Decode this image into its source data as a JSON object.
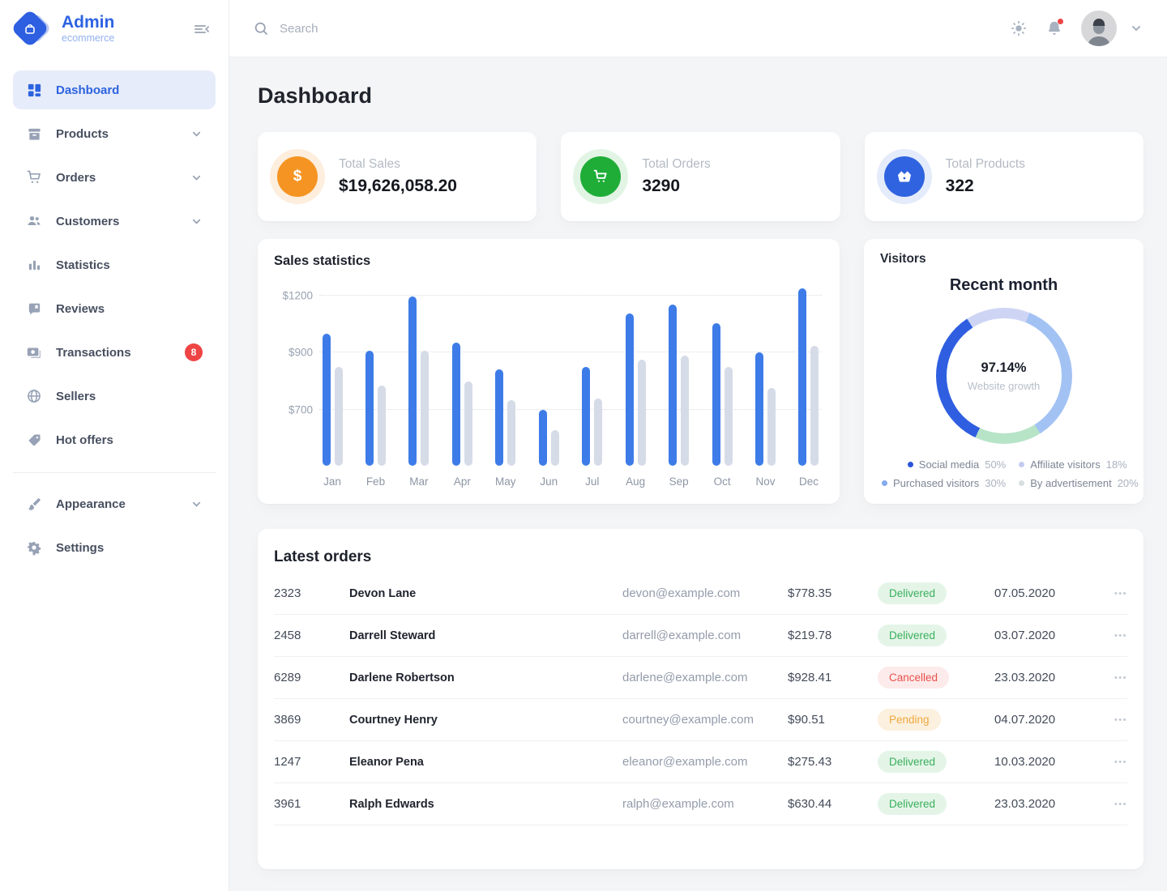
{
  "brand": {
    "name": "Admin",
    "subtitle": "ecommerce"
  },
  "topbar": {
    "search_placeholder": "Search"
  },
  "sidebar": {
    "items": [
      {
        "label": "Dashboard",
        "active": true
      },
      {
        "label": "Products",
        "chevron": true
      },
      {
        "label": "Orders",
        "chevron": true
      },
      {
        "label": "Customers",
        "chevron": true
      },
      {
        "label": "Statistics"
      },
      {
        "label": "Reviews"
      },
      {
        "label": "Transactions",
        "badge": "8"
      },
      {
        "label": "Sellers"
      },
      {
        "label": "Hot offers"
      }
    ],
    "footer_items": [
      {
        "label": "Appearance",
        "chevron": true
      },
      {
        "label": "Settings"
      }
    ]
  },
  "page": {
    "title": "Dashboard"
  },
  "stats": [
    {
      "label": "Total Sales",
      "value": "$19,626,058.20",
      "color": "#f59422",
      "halo": "#fdeedd",
      "icon": "dollar-icon"
    },
    {
      "label": "Total Orders",
      "value": "3290",
      "color": "#1fad38",
      "halo": "#e2f5e5",
      "icon": "cart-icon"
    },
    {
      "label": "Total Products",
      "value": "322",
      "color": "#2f63e0",
      "halo": "#e4ebfa",
      "icon": "basket-icon"
    }
  ],
  "chart_data": {
    "type": "bar",
    "title": "Sales statistics",
    "categories": [
      "Jan",
      "Feb",
      "Mar",
      "Apr",
      "May",
      "Jun",
      "Jul",
      "Aug",
      "Sep",
      "Oct",
      "Nov",
      "Dec"
    ],
    "series": [
      {
        "name": "current",
        "color": "#3d7ce8",
        "values": [
          1000,
          910,
          1195,
          950,
          840,
          700,
          850,
          1105,
          1155,
          1055,
          900,
          1240
        ]
      },
      {
        "name": "previous",
        "color": "#d5dbe7",
        "values": [
          850,
          785,
          910,
          800,
          735,
          635,
          740,
          875,
          890,
          850,
          775,
          935
        ]
      }
    ],
    "yticks": [
      {
        "label": "$700",
        "value": 700
      },
      {
        "label": "$900",
        "value": 900
      },
      {
        "label": "$1200",
        "value": 1200
      }
    ],
    "ylim": [
      520,
      1250
    ],
    "grid": "dotted-horizontal",
    "legend_position": "none"
  },
  "visitors": {
    "title": "Visitors",
    "heading": "Recent month",
    "center_value": "97.14%",
    "center_label": "Website growth",
    "donut_arcs": [
      {
        "color": "#a3c2f4",
        "from": 22,
        "to": 148
      },
      {
        "color": "#b7e4c7",
        "from": 148,
        "to": 205
      },
      {
        "color": "#2f5fe0",
        "from": 205,
        "to": 327
      },
      {
        "color": "#ced5f4",
        "from": 327,
        "to": 382
      }
    ],
    "legend": [
      {
        "label": "Social media",
        "pct": "50%",
        "color": "#2b55d9"
      },
      {
        "label": "Affiliate visitors",
        "pct": "18%",
        "color": "#c3cbf1"
      },
      {
        "label": "Purchased visitors",
        "pct": "30%",
        "color": "#86abef"
      },
      {
        "label": "By advertisement",
        "pct": "20%",
        "color": "#d7dee0"
      }
    ]
  },
  "orders": {
    "title": "Latest orders",
    "rows": [
      {
        "id": "2323",
        "name": "Devon Lane",
        "email": "devon@example.com",
        "amount": "$778.35",
        "status": "Delivered",
        "date": "07.05.2020"
      },
      {
        "id": "2458",
        "name": "Darrell Steward",
        "email": "darrell@example.com",
        "amount": "$219.78",
        "status": "Delivered",
        "date": "03.07.2020"
      },
      {
        "id": "6289",
        "name": "Darlene Robertson",
        "email": "darlene@example.com",
        "amount": "$928.41",
        "status": "Cancelled",
        "date": "23.03.2020"
      },
      {
        "id": "3869",
        "name": "Courtney Henry",
        "email": "courtney@example.com",
        "amount": "$90.51",
        "status": "Pending",
        "date": "04.07.2020"
      },
      {
        "id": "1247",
        "name": "Eleanor Pena",
        "email": "eleanor@example.com",
        "amount": "$275.43",
        "status": "Delivered",
        "date": "10.03.2020"
      },
      {
        "id": "3961",
        "name": "Ralph Edwards",
        "email": "ralph@example.com",
        "amount": "$630.44",
        "status": "Delivered",
        "date": "23.03.2020"
      }
    ],
    "status_colors": {
      "Delivered": {
        "fg": "#3aaf5c",
        "bg": "#e4f5e8"
      },
      "Cancelled": {
        "fg": "#e8504e",
        "bg": "#fcebea"
      },
      "Pending": {
        "fg": "#efa93e",
        "bg": "#fcf0de"
      }
    },
    "row_menu_glyph": "•••"
  }
}
